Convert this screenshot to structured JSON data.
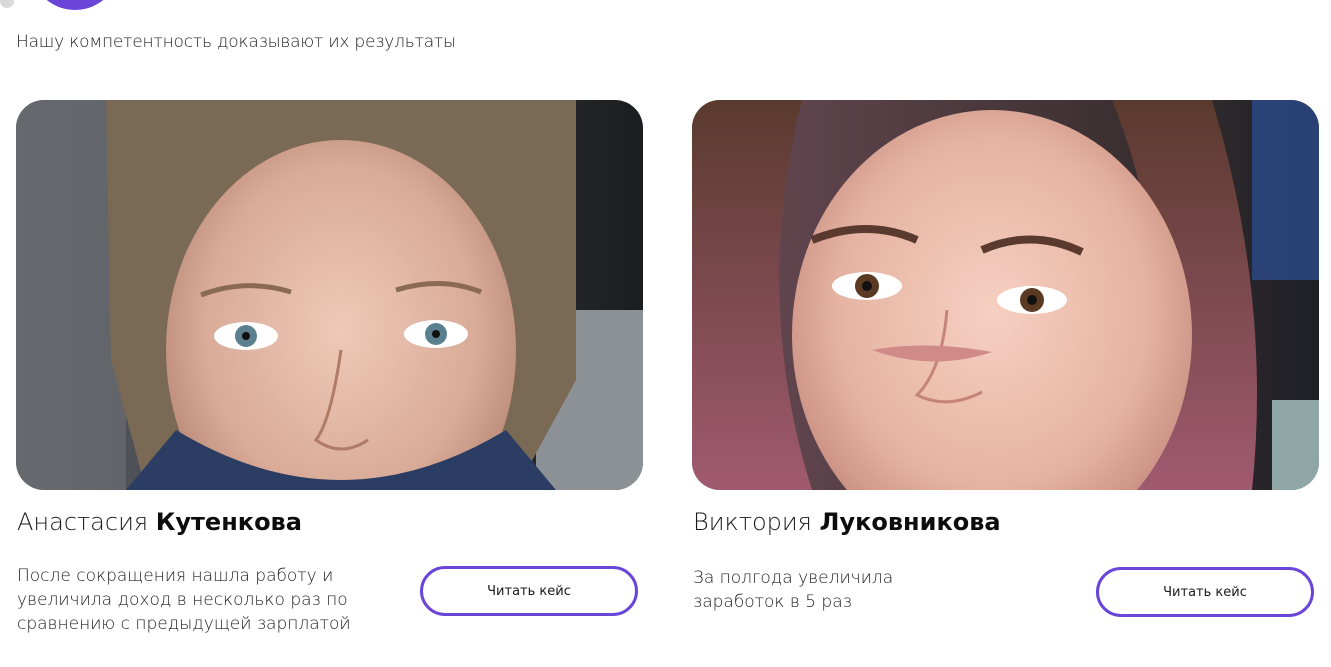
{
  "section": {
    "subtitle": "Нашу компетентность доказывают их результаты"
  },
  "cases": [
    {
      "first_name": "Анастасия",
      "last_name": "Кутенкова",
      "description": "После сокращения нашла работу и увеличила доход в несколько раз по сравнению с предыдущей зарплатой",
      "button_label": "Читать кейс"
    },
    {
      "first_name": "Виктория",
      "last_name": "Луковникова",
      "description": "За полгода увеличила заработок в 5 раз",
      "button_label": "Читать кейс"
    }
  ],
  "colors": {
    "accent": "#6a45d8"
  }
}
